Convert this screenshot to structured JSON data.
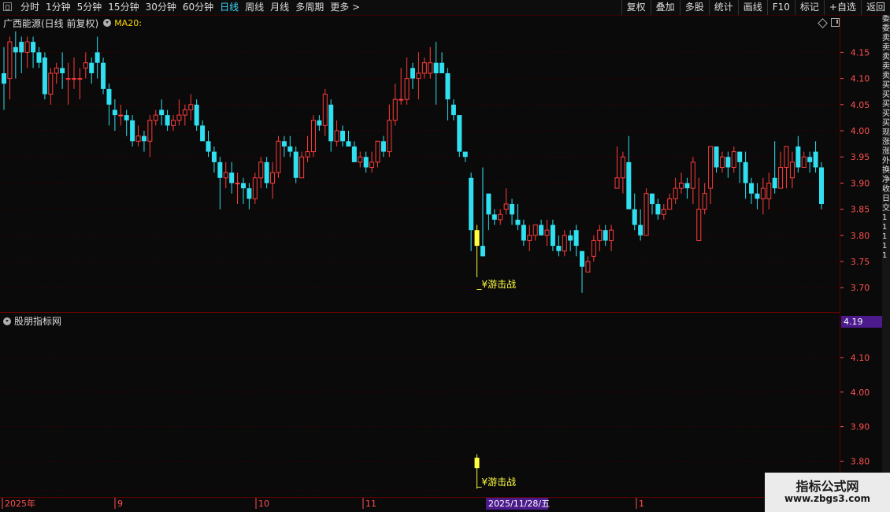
{
  "toolbar": {
    "periods": [
      "分时",
      "1分钟",
      "5分钟",
      "15分钟",
      "30分钟",
      "60分钟",
      "日线",
      "周线",
      "月线",
      "多周期",
      "更多 >"
    ],
    "active_period": "日线",
    "right_buttons": [
      "复权",
      "叠加",
      "多股",
      "统计",
      "画线",
      "F10",
      "标记",
      "+自选",
      "返回"
    ]
  },
  "main_chart": {
    "title": "广西能源(日线 前复权)",
    "ma_label": "MA20:",
    "price_labels": [
      "4.15",
      "4.10",
      "4.05",
      "4.00",
      "3.95",
      "3.90",
      "3.85",
      "3.80",
      "3.75",
      "3.70"
    ],
    "annotation": "_¥游击战"
  },
  "indicator": {
    "title": "股朋指标网",
    "price_tag": "4.19",
    "price_labels": [
      "4.10",
      "4.00",
      "3.90",
      "3.80"
    ],
    "annotation": "_¥游击战"
  },
  "date_axis": {
    "labels": [
      "2025年",
      "9",
      "10",
      "11",
      "1"
    ],
    "highlight": "2025/11/28/五"
  },
  "right_strip": [
    "委",
    "委",
    "卖",
    "卖",
    "卖",
    "卖",
    "卖",
    "买",
    "买",
    "买",
    "买",
    "买",
    "现",
    "涨",
    "涨",
    "外",
    "换",
    "净",
    "收",
    "日",
    "交",
    "1",
    "1",
    "1",
    "1",
    "1"
  ],
  "watermark": {
    "line1": "指标公式网",
    "line2": "www.zbgs3.com"
  },
  "colors": {
    "up": "#ff3c3c",
    "down": "#30e0f0",
    "signal": "#ffff40",
    "axis": "#ff5050",
    "grid": "#3a0000"
  },
  "chart_data": {
    "type": "candlestick",
    "ylim": [
      3.68,
      4.18
    ],
    "candles": [
      [
        4.11,
        4.09,
        4.16,
        4.04
      ],
      [
        4.1,
        4.17,
        4.18,
        4.06
      ],
      [
        4.16,
        4.15,
        4.19,
        4.1
      ],
      [
        4.17,
        4.15,
        4.18,
        4.11
      ],
      [
        4.15,
        4.17,
        4.18,
        4.12
      ],
      [
        4.17,
        4.15,
        4.18,
        4.12
      ],
      [
        4.15,
        4.13,
        4.16,
        4.12
      ],
      [
        4.14,
        4.07,
        4.15,
        4.06
      ],
      [
        4.07,
        4.11,
        4.12,
        4.05
      ],
      [
        4.11,
        4.12,
        4.13,
        4.09
      ],
      [
        4.12,
        4.11,
        4.15,
        4.08
      ],
      [
        4.1,
        4.1,
        4.13,
        4.05
      ],
      [
        4.1,
        4.1,
        4.14,
        4.08
      ],
      [
        4.1,
        4.1,
        4.12,
        4.06
      ],
      [
        4.12,
        4.13,
        4.15,
        4.1
      ],
      [
        4.13,
        4.11,
        4.14,
        4.09
      ],
      [
        4.15,
        4.13,
        4.18,
        4.1
      ],
      [
        4.13,
        4.08,
        4.14,
        4.07
      ],
      [
        4.08,
        4.05,
        4.09,
        4.01
      ],
      [
        4.04,
        4.03,
        4.06,
        4.0
      ],
      [
        4.03,
        4.03,
        4.05,
        4.01
      ],
      [
        4.03,
        4.02,
        4.04,
        3.99
      ],
      [
        4.02,
        3.98,
        4.03,
        3.97
      ],
      [
        3.98,
        3.99,
        4.01,
        3.97
      ],
      [
        3.99,
        3.98,
        4.0,
        3.96
      ],
      [
        3.98,
        4.02,
        4.03,
        3.95
      ],
      [
        4.02,
        4.03,
        4.04,
        4.01
      ],
      [
        4.04,
        4.03,
        4.06,
        4.01
      ],
      [
        4.03,
        4.01,
        4.04,
        4.0
      ],
      [
        4.01,
        4.02,
        4.03,
        4.0
      ],
      [
        4.02,
        4.03,
        4.06,
        4.01
      ],
      [
        4.03,
        4.04,
        4.05,
        4.01
      ],
      [
        4.04,
        4.05,
        4.07,
        4.02
      ],
      [
        4.05,
        4.01,
        4.06,
        4.0
      ],
      [
        4.01,
        3.98,
        4.02,
        3.98
      ],
      [
        3.98,
        3.96,
        4.0,
        3.95
      ],
      [
        3.96,
        3.94,
        3.97,
        3.92
      ],
      [
        3.94,
        3.91,
        3.95,
        3.85
      ],
      [
        3.91,
        3.92,
        3.94,
        3.89
      ],
      [
        3.92,
        3.9,
        3.94,
        3.88
      ],
      [
        3.9,
        3.9,
        3.92,
        3.86
      ],
      [
        3.9,
        3.89,
        3.91,
        3.86
      ],
      [
        3.89,
        3.87,
        3.9,
        3.85
      ],
      [
        3.87,
        3.91,
        3.92,
        3.86
      ],
      [
        3.91,
        3.94,
        3.95,
        3.89
      ],
      [
        3.94,
        3.9,
        3.95,
        3.89
      ],
      [
        3.9,
        3.92,
        3.94,
        3.87
      ],
      [
        3.92,
        3.98,
        3.99,
        3.91
      ],
      [
        3.98,
        3.97,
        3.99,
        3.95
      ],
      [
        3.97,
        3.96,
        3.99,
        3.95
      ],
      [
        3.96,
        3.91,
        3.97,
        3.9
      ],
      [
        3.91,
        3.95,
        3.96,
        3.93
      ],
      [
        3.95,
        3.96,
        3.99,
        3.94
      ],
      [
        3.96,
        4.02,
        4.03,
        3.95
      ],
      [
        4.02,
        4.01,
        4.03,
        4.0
      ],
      [
        4.01,
        4.07,
        4.08,
        3.99
      ],
      [
        4.05,
        3.98,
        4.06,
        3.96
      ],
      [
        3.98,
        4.0,
        4.02,
        3.97
      ],
      [
        4.0,
        3.98,
        4.01,
        3.97
      ],
      [
        3.98,
        3.97,
        4.0,
        3.97
      ],
      [
        3.97,
        3.94,
        3.98,
        3.94
      ],
      [
        3.94,
        3.95,
        3.96,
        3.93
      ],
      [
        3.95,
        3.93,
        3.96,
        3.92
      ],
      [
        3.93,
        3.94,
        3.96,
        3.92
      ],
      [
        3.94,
        3.98,
        3.98,
        3.93
      ],
      [
        3.98,
        3.96,
        3.99,
        3.95
      ],
      [
        3.96,
        4.02,
        4.05,
        3.95
      ],
      [
        4.02,
        4.06,
        4.09,
        4.01
      ],
      [
        4.06,
        4.06,
        4.12,
        4.05
      ],
      [
        4.06,
        4.1,
        4.14,
        4.05
      ],
      [
        4.12,
        4.1,
        4.13,
        4.08
      ],
      [
        4.1,
        4.11,
        4.15,
        4.06
      ],
      [
        4.11,
        4.13,
        4.14,
        4.1
      ],
      [
        4.11,
        4.13,
        4.16,
        4.1
      ],
      [
        4.13,
        4.11,
        4.17,
        4.05
      ],
      [
        4.13,
        4.11,
        4.15,
        4.11
      ],
      [
        4.11,
        4.06,
        4.12,
        4.02
      ],
      [
        4.05,
        4.03,
        4.06,
        4.02
      ],
      [
        4.03,
        3.96,
        4.03,
        3.95
      ],
      [
        3.96,
        3.95,
        3.96,
        3.94
      ],
      [
        3.91,
        3.81,
        3.92,
        3.77
      ],
      [
        3.81,
        3.78,
        3.82,
        3.72
      ],
      [
        3.78,
        3.76,
        3.93,
        3.76
      ],
      [
        3.88,
        3.84,
        3.88,
        3.81
      ],
      [
        3.84,
        3.83,
        3.85,
        3.82
      ],
      [
        3.83,
        3.84,
        3.85,
        3.82
      ],
      [
        3.85,
        3.86,
        3.89,
        3.84
      ],
      [
        3.86,
        3.84,
        3.87,
        3.82
      ],
      [
        3.83,
        3.82,
        3.86,
        3.81
      ],
      [
        3.82,
        3.79,
        3.83,
        3.78
      ],
      [
        3.79,
        3.8,
        3.82,
        3.77
      ],
      [
        3.8,
        3.82,
        3.82,
        3.79
      ],
      [
        3.82,
        3.8,
        3.83,
        3.8
      ],
      [
        3.8,
        3.81,
        3.83,
        3.78
      ],
      [
        3.82,
        3.78,
        3.83,
        3.77
      ],
      [
        3.78,
        3.77,
        3.8,
        3.76
      ],
      [
        3.77,
        3.8,
        3.81,
        3.76
      ],
      [
        3.8,
        3.79,
        3.81,
        3.77
      ],
      [
        3.81,
        3.78,
        3.82,
        3.76
      ],
      [
        3.77,
        3.74,
        3.77,
        3.69
      ],
      [
        3.73,
        3.75,
        3.76,
        3.73
      ],
      [
        3.76,
        3.79,
        3.8,
        3.75
      ],
      [
        3.79,
        3.81,
        3.82,
        3.77
      ],
      [
        3.81,
        3.79,
        3.82,
        3.78
      ],
      [
        3.79,
        3.81,
        3.82,
        3.77
      ],
      [
        3.89,
        3.91,
        3.97,
        3.89
      ],
      [
        3.91,
        3.95,
        3.96,
        3.88
      ],
      [
        3.94,
        3.85,
        3.99,
        3.85
      ],
      [
        3.85,
        3.82,
        3.88,
        3.81
      ],
      [
        3.82,
        3.8,
        3.85,
        3.79
      ],
      [
        3.8,
        3.88,
        3.89,
        3.8
      ],
      [
        3.88,
        3.86,
        3.88,
        3.84
      ],
      [
        3.86,
        3.84,
        3.87,
        3.83
      ],
      [
        3.84,
        3.85,
        3.86,
        3.83
      ],
      [
        3.85,
        3.87,
        3.88,
        3.86
      ],
      [
        3.87,
        3.89,
        3.91,
        3.86
      ],
      [
        3.89,
        3.9,
        3.92,
        3.88
      ],
      [
        3.9,
        3.89,
        3.91,
        3.87
      ],
      [
        3.89,
        3.94,
        3.95,
        3.86
      ],
      [
        3.79,
        3.85,
        3.91,
        3.79
      ],
      [
        3.85,
        3.88,
        3.9,
        3.84
      ],
      [
        3.89,
        3.97,
        3.97,
        3.86
      ],
      [
        3.97,
        3.93,
        3.97,
        3.92
      ],
      [
        3.93,
        3.95,
        3.96,
        3.92
      ],
      [
        3.95,
        3.93,
        3.96,
        3.91
      ],
      [
        3.93,
        3.96,
        3.97,
        3.92
      ],
      [
        3.96,
        3.94,
        3.96,
        3.9
      ],
      [
        3.94,
        3.9,
        3.96,
        3.87
      ],
      [
        3.9,
        3.88,
        3.91,
        3.86
      ],
      [
        3.88,
        3.87,
        3.9,
        3.85
      ],
      [
        3.87,
        3.89,
        3.91,
        3.84
      ],
      [
        3.87,
        3.9,
        3.92,
        3.85
      ],
      [
        3.91,
        3.89,
        3.98,
        3.88
      ],
      [
        3.89,
        3.93,
        3.96,
        3.89
      ],
      [
        3.93,
        3.97,
        3.97,
        3.89
      ],
      [
        3.91,
        3.94,
        3.96,
        3.89
      ],
      [
        3.97,
        3.93,
        3.99,
        3.92
      ],
      [
        3.93,
        3.95,
        3.96,
        3.93
      ],
      [
        3.95,
        3.94,
        3.96,
        3.92
      ],
      [
        3.96,
        3.93,
        3.98,
        3.92
      ],
      [
        3.93,
        3.86,
        3.94,
        3.85
      ]
    ],
    "signal_candle_index": 81
  }
}
